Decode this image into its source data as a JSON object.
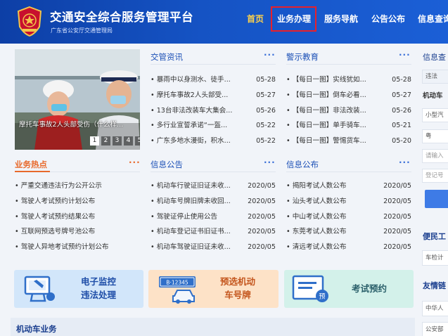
{
  "header": {
    "title": "交通安全综合服务管理平台",
    "subtitle": "广东省公安厅交通管理局",
    "nav": [
      "首页",
      "业务办理",
      "服务导航",
      "公告公布",
      "信息查询"
    ],
    "active_nav": "首页",
    "highlighted_nav": "业务办理"
  },
  "carousel": {
    "caption": "摩托车事故2人头部受伤（什么样...",
    "pages": [
      "1",
      "2",
      "3",
      "4",
      "5"
    ],
    "active_page": "1"
  },
  "panels": {
    "jiaoguan": {
      "title": "交管资讯",
      "more": "···",
      "items": [
        {
          "title": "暴雨中以身测水、徒手...",
          "date": "05-28"
        },
        {
          "title": "摩托车事故2人头部受...",
          "date": "05-27"
        },
        {
          "title": "13台非法改装车大集会...",
          "date": "05-26"
        },
        {
          "title": "多行业宣誓承诺“一盔...",
          "date": "05-22"
        },
        {
          "title": "广东多地水漫街，积水...",
          "date": "05-22"
        }
      ]
    },
    "jingshi": {
      "title": "警示教育",
      "more": "···",
      "items": [
        {
          "title": "【每日一图】实线犹如...",
          "date": "05-28"
        },
        {
          "title": "【每日一图】倒车必看...",
          "date": "05-27"
        },
        {
          "title": "【每日一图】非法改装...",
          "date": "05-26"
        },
        {
          "title": "【每日一图】单手骑车...",
          "date": "05-21"
        },
        {
          "title": "【每日一图】警惕货车...",
          "date": "05-20"
        }
      ]
    },
    "redian": {
      "title": "业务热点",
      "more": "···",
      "items": [
        {
          "title": "严重交通违法行为公开公示"
        },
        {
          "title": "驾驶人考试预约计划公布"
        },
        {
          "title": "驾驶人考试预约结果公布"
        },
        {
          "title": "互联网预选号牌号池公布"
        },
        {
          "title": "驾驶人异地考试预约计划公布"
        }
      ]
    },
    "xinxi_gonggao": {
      "title": "信息公告",
      "more": "···",
      "items": [
        {
          "title": "机动车行驶证旧证未收...",
          "date": "2020/05"
        },
        {
          "title": "机动车号牌旧牌未收回...",
          "date": "2020/05"
        },
        {
          "title": "驾驶证停止使用公告",
          "date": "2020/05"
        },
        {
          "title": "机动车登记证书旧证书...",
          "date": "2020/05"
        },
        {
          "title": "机动车驾驶证旧证未收...",
          "date": "2020/05"
        }
      ]
    },
    "xinxi_gongbu": {
      "title": "信息公布",
      "more": "···",
      "items": [
        {
          "title": "揭阳考试人数公布",
          "date": "2020/05"
        },
        {
          "title": "汕头考试人数公布",
          "date": "2020/05"
        },
        {
          "title": "中山考试人数公布",
          "date": "2020/05"
        },
        {
          "title": "东莞考试人数公布",
          "date": "2020/05"
        },
        {
          "title": "清远考试人数公布",
          "date": "2020/05"
        }
      ]
    }
  },
  "cards": [
    {
      "line1": "电子监控",
      "line2": "违法处理"
    },
    {
      "line1": "预选机动",
      "line2": "车号牌",
      "plate_text": "B·12345"
    },
    {
      "line1": "考试预约",
      "badge": "预"
    }
  ],
  "bottom": {
    "title": "机动车业务"
  },
  "right_sidebar": {
    "head1": "信息查",
    "tab": "违法",
    "label1": "机动车",
    "select1": "小型汽",
    "select2": "粤",
    "input1": "请输入",
    "input2": "登记号",
    "head2": "便民工",
    "item2": "车检计",
    "head3": "友情链",
    "item3": "中华人",
    "item4": "公安部"
  },
  "colors": {
    "header_blue": "#1553c4",
    "active_nav": "#ffd24a",
    "highlight_red": "#e8202a",
    "orange_accent": "#e8692b",
    "link_blue": "#1b4fb6"
  }
}
